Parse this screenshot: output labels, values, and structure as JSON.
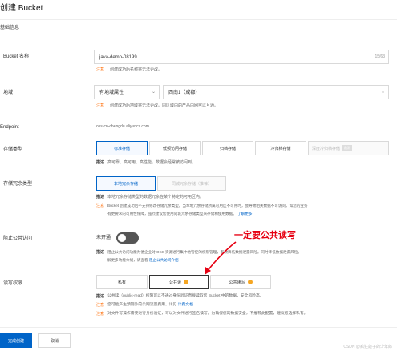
{
  "page": {
    "title": "创建 Bucket",
    "section": "基础信息"
  },
  "bucket_name": {
    "label": "Bucket 名称",
    "value": "java-demo-08199",
    "counter": "15/63",
    "tag": "注意",
    "hint": "创建成功后名称将无法更改。"
  },
  "region": {
    "label": "地域",
    "region_type": "有地域属性",
    "value": "西南1（成都）",
    "tag": "注意",
    "hint": "创建成功后地域将无法更改。同区域内的产品内网可以互通。"
  },
  "endpoint": {
    "label": "Endpoint",
    "value": "oss-cn-chengdu.aliyuncs.com"
  },
  "storage_class": {
    "label": "存储类型",
    "options": [
      "标准存储",
      "低频访问存储",
      "归档存储",
      "冷归档存储",
      "深度冷归档存储"
    ],
    "badge": "邀测",
    "selected": "标准存储",
    "desc_tag": "描述",
    "desc": "高可靠、高可用、高性能，数据会经常被访问到。"
  },
  "redundancy": {
    "label": "存储冗余类型",
    "options": [
      "本地冗余存储",
      "同城冗余存储（推荐）"
    ],
    "selected": "本地冗余存储",
    "desc_tag": "描述",
    "desc": "本地冗余存储类型的数据冗余在某个特定的可用区内。",
    "note_tag": "注意",
    "note1": "Bucket 创建成功后不支持修改存储冗余类型。当本地冗余存储所属可用区不可用时，会导致相关数据不可访问，如您的业务",
    "note2": "有更要求的可用性保障，强烈建议您使用同城冗余存储类型来存储和使用数据。",
    "more_link": "了解更多"
  },
  "block_public": {
    "label": "阻止公共访问",
    "toggle_text": "未开通",
    "desc_tag": "描述",
    "desc1": "阻止公共访问功能为便企业对 OSS 资源进行集中地管控的权限管理，有效降低数据泄露风险。同时降低数据泄漏风险。",
    "desc2": "解更多功能介绍，请查看",
    "desc_link": "阻止公共访问介绍"
  },
  "acl": {
    "label": "读写权限",
    "options": [
      "私有",
      "公共读",
      "公共读写"
    ],
    "selected": "公共读",
    "desc_tag": "描述",
    "desc": "公共读（public-read）权限可以不通过身份验证直接读取您 Bucket 中的数据，安全风险高。",
    "note1_tag": "注意",
    "note1": "您可能产生预期外的公网流量费用，详见",
    "note1_link": "计费文档",
    "note2_tag": "注意",
    "note2": "对文件写操作需要进行身份验证，可以对文件进行签名读写。为确保您的数据安全，不推荐此配置，建议您选择私有。"
  },
  "annotation": {
    "text": "一定要公共读写",
    "color": "#e60012"
  },
  "footer": {
    "confirm": "完成创建",
    "cancel": "取消"
  },
  "watermark": "CSDN @疯狂敲子的少年郎"
}
